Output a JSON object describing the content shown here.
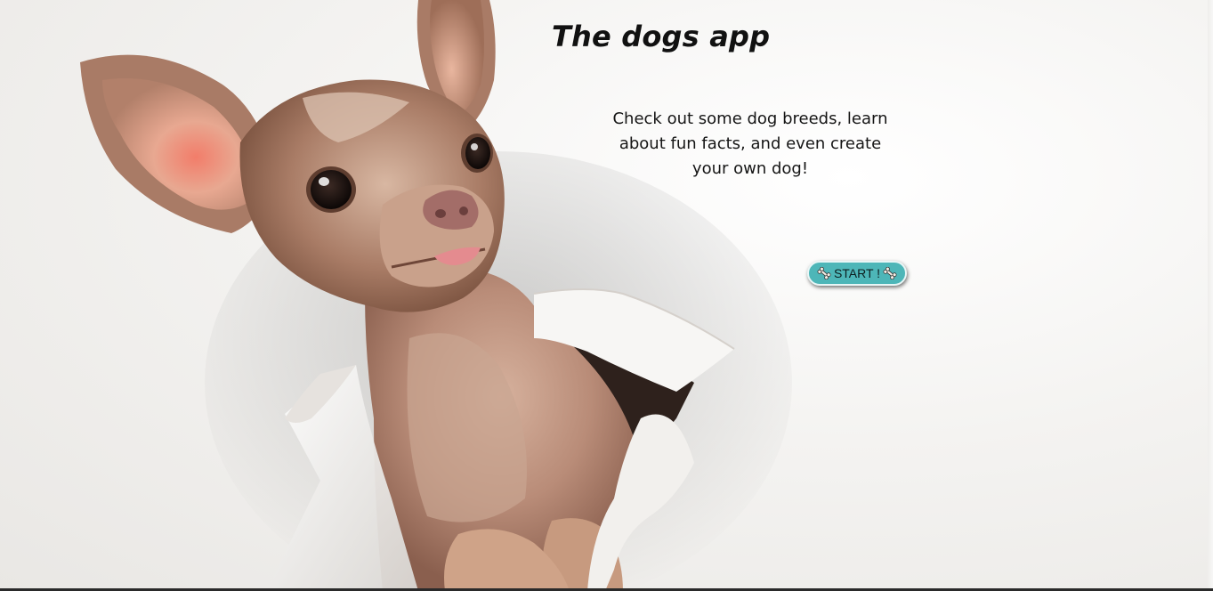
{
  "app": {
    "title": "The dogs app",
    "description": "Check out some dog breeds, learn about fun facts, and even create your own dog!"
  },
  "start_button": {
    "label": "START !",
    "icon": "bone-icon",
    "color": "#4db6b8"
  },
  "hero_image": {
    "subject": "chihuahua-icon"
  }
}
